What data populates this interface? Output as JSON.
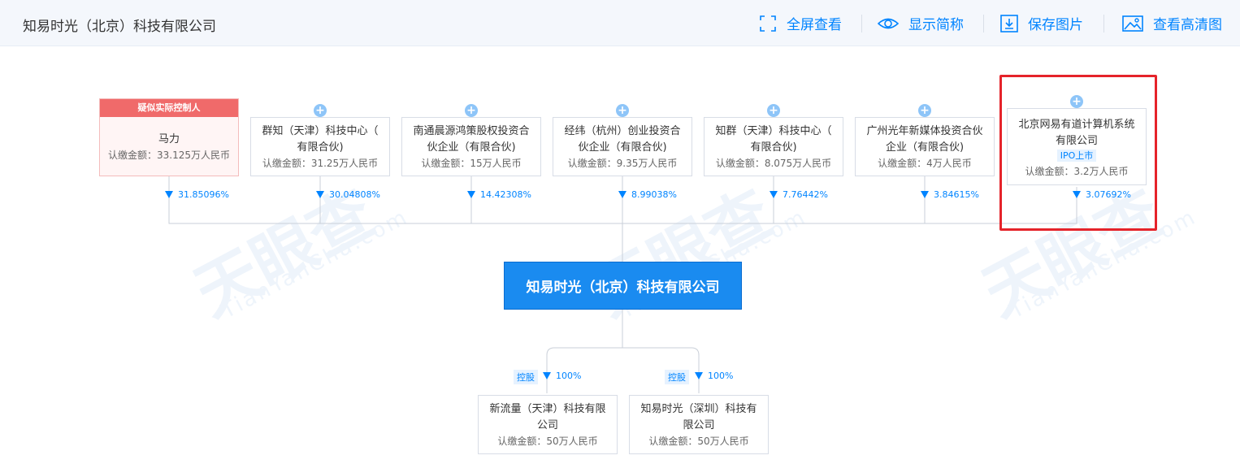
{
  "header": {
    "title": "知易时光（北京）科技有限公司",
    "tools": [
      {
        "label": "全屏查看",
        "icon": "fullscreen-icon"
      },
      {
        "label": "显示简称",
        "icon": "eye-icon"
      },
      {
        "label": "保存图片",
        "icon": "download-icon"
      },
      {
        "label": "查看高清图",
        "icon": "image-icon"
      }
    ]
  },
  "watermark": {
    "text": "天眼查",
    "sub": "TianYanCha.com"
  },
  "controller_tag": "疑似实际控制人",
  "shareholders": [
    {
      "name_lines": [
        "马力"
      ],
      "amount": "认缴金额：33.125万人民币",
      "percent": "31.85096%",
      "controller": true
    },
    {
      "name_lines": [
        "群知（天津）科技中心（",
        "有限合伙)"
      ],
      "amount": "认缴金额：31.25万人民币",
      "percent": "30.04808%"
    },
    {
      "name_lines": [
        "南通晨源鸿策股权投资合",
        "伙企业（有限合伙)"
      ],
      "amount": "认缴金额：15万人民币",
      "percent": "14.42308%"
    },
    {
      "name_lines": [
        "经纬（杭州）创业投资合",
        "伙企业（有限合伙)"
      ],
      "amount": "认缴金额：9.35万人民币",
      "percent": "8.99038%"
    },
    {
      "name_lines": [
        "知群（天津）科技中心（",
        "有限合伙)"
      ],
      "amount": "认缴金额：8.075万人民币",
      "percent": "7.76442%"
    },
    {
      "name_lines": [
        "广州光年新媒体投资合伙",
        "企业（有限合伙)"
      ],
      "amount": "认缴金额：4万人民币",
      "percent": "3.84615%"
    },
    {
      "name_lines": [
        "北京网易有道计算机系统",
        "有限公司"
      ],
      "badge": "IPO上市",
      "amount": "认缴金额：3.2万人民币",
      "percent": "3.07692%"
    }
  ],
  "center_company": "知易时光（北京）科技有限公司",
  "subsidiaries": [
    {
      "tag": "控股",
      "percent": "100%",
      "name_lines": [
        "新流量（天津）科技有限",
        "公司"
      ],
      "amount": "认缴金额：50万人民币"
    },
    {
      "tag": "控股",
      "percent": "100%",
      "name_lines": [
        "知易时光（深圳）科技有",
        "限公司"
      ],
      "amount": "认缴金额：50万人民币"
    }
  ],
  "colors": {
    "accent": "#0084ff",
    "center": "#1a8bf0",
    "controller": "#f06a6a",
    "highlight": "#e5232a"
  }
}
